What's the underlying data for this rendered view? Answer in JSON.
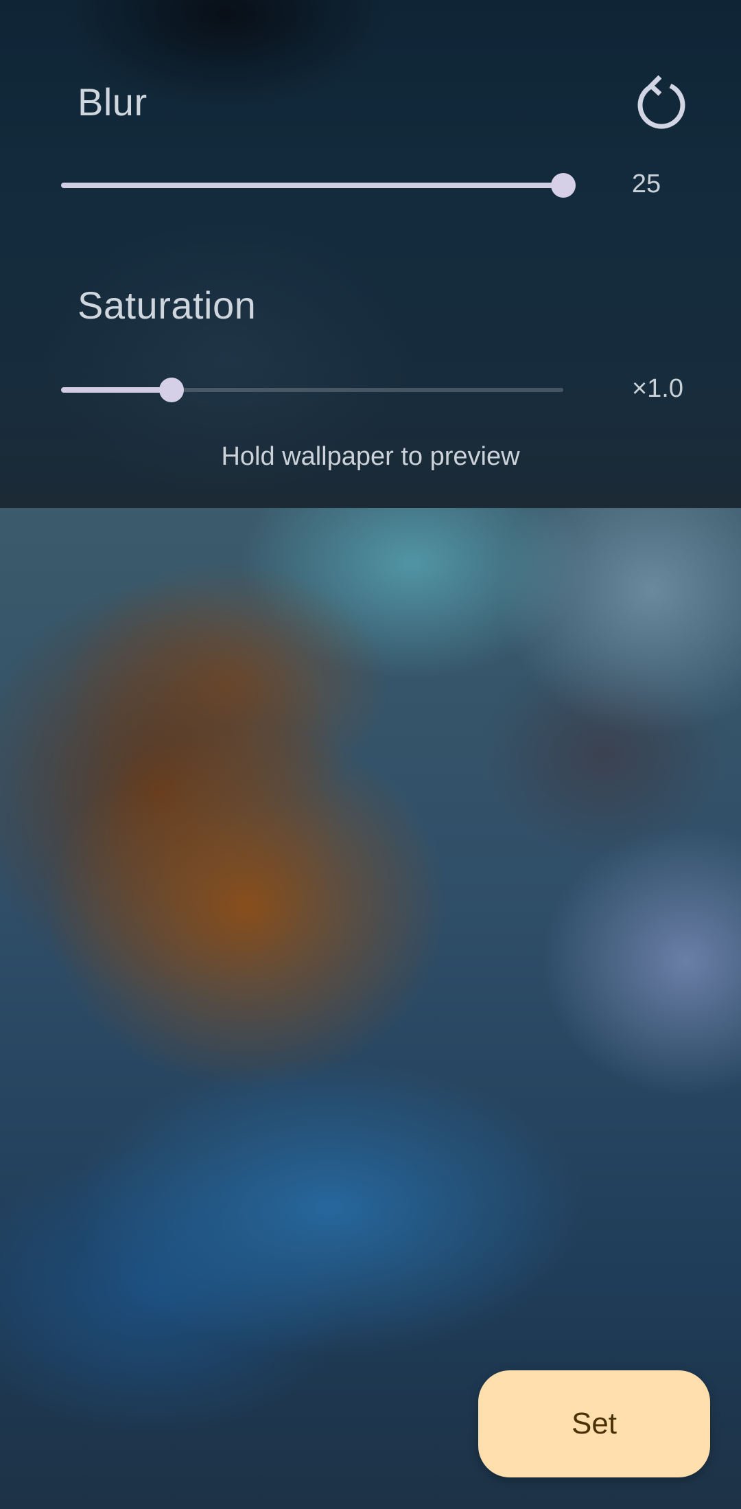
{
  "blur": {
    "label": "Blur",
    "value_text": "25",
    "level": 1.0
  },
  "saturation": {
    "label": "Saturation",
    "value_text": "×1.0",
    "level": 0.2
  },
  "reset": {
    "icon": "reset-icon"
  },
  "hint": "Hold wallpaper to preview",
  "set_button": {
    "label": "Set"
  },
  "colors": {
    "slider_active": "#d2cde4",
    "thumb": "#d6cfe8",
    "set_button_bg": "#ffdfad",
    "set_button_text": "#4b3106"
  }
}
